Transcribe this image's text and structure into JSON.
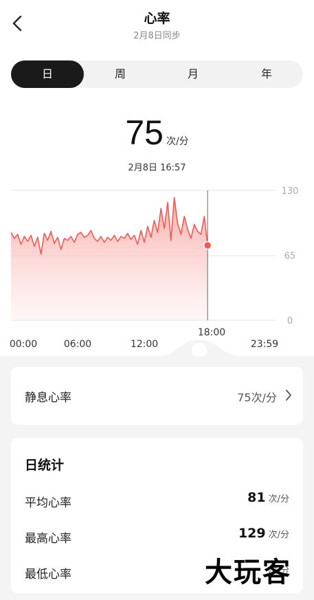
{
  "header": {
    "title": "心率",
    "subtitle": "2月8日同步"
  },
  "tabs": [
    {
      "label": "日",
      "active": true
    },
    {
      "label": "周",
      "active": false
    },
    {
      "label": "月",
      "active": false
    },
    {
      "label": "年",
      "active": false
    }
  ],
  "current": {
    "value": "75",
    "unit": "次/分",
    "datetime": "2月8日 16:57"
  },
  "chart_data": {
    "type": "area",
    "x_tick_labels": [
      "00:00",
      "06:00",
      "12:00",
      "18:00",
      "23:59"
    ],
    "y_tick_labels": [
      "130",
      "65",
      "0"
    ],
    "ylim": [
      0,
      130
    ],
    "xlim_hours": [
      0,
      24
    ],
    "cursor": {
      "time_label": "18:00",
      "value": 75
    },
    "series": [
      {
        "color": "#f05a55",
        "x_hours": [
          0.0,
          0.3,
          0.6,
          0.9,
          1.2,
          1.5,
          1.8,
          2.1,
          2.4,
          2.7,
          3.0,
          3.3,
          3.6,
          3.9,
          4.2,
          4.5,
          4.8,
          5.1,
          5.4,
          5.7,
          6.0,
          6.3,
          6.6,
          6.9,
          7.2,
          7.5,
          7.8,
          8.1,
          8.4,
          8.7,
          9.0,
          9.3,
          9.6,
          9.9,
          10.2,
          10.5,
          10.8,
          11.1,
          11.4,
          11.7,
          12.0,
          12.3,
          12.6,
          12.9,
          13.2,
          13.5,
          13.8,
          14.1,
          14.4,
          14.7,
          15.0,
          15.3,
          15.6,
          15.9,
          16.2,
          16.5,
          16.8,
          17.1,
          17.4,
          17.7
        ],
        "values": [
          88,
          82,
          86,
          76,
          84,
          79,
          85,
          74,
          83,
          66,
          87,
          80,
          89,
          77,
          83,
          71,
          82,
          80,
          84,
          78,
          86,
          88,
          83,
          85,
          90,
          82,
          79,
          84,
          78,
          83,
          80,
          85,
          79,
          84,
          82,
          87,
          81,
          85,
          76,
          90,
          78,
          94,
          83,
          100,
          88,
          112,
          92,
          118,
          80,
          123,
          97,
          86,
          104,
          91,
          82,
          96,
          89,
          86,
          104,
          75
        ]
      }
    ]
  },
  "resting": {
    "label": "静息心率",
    "value": "75次/分"
  },
  "daily": {
    "heading": "日统计",
    "unit": "次/分",
    "stats": [
      {
        "name": "平均心率",
        "value": "81"
      },
      {
        "name": "最高心率",
        "value": "129"
      },
      {
        "name": "最低心率",
        "value": ""
      }
    ]
  },
  "watermark": "大玩客",
  "colors": {
    "accent": "#f05a55",
    "active_tab": "#1a1a1a"
  },
  "icons": {
    "back": "chevron-left-icon",
    "resting_arrow": "chevron-right-icon"
  }
}
